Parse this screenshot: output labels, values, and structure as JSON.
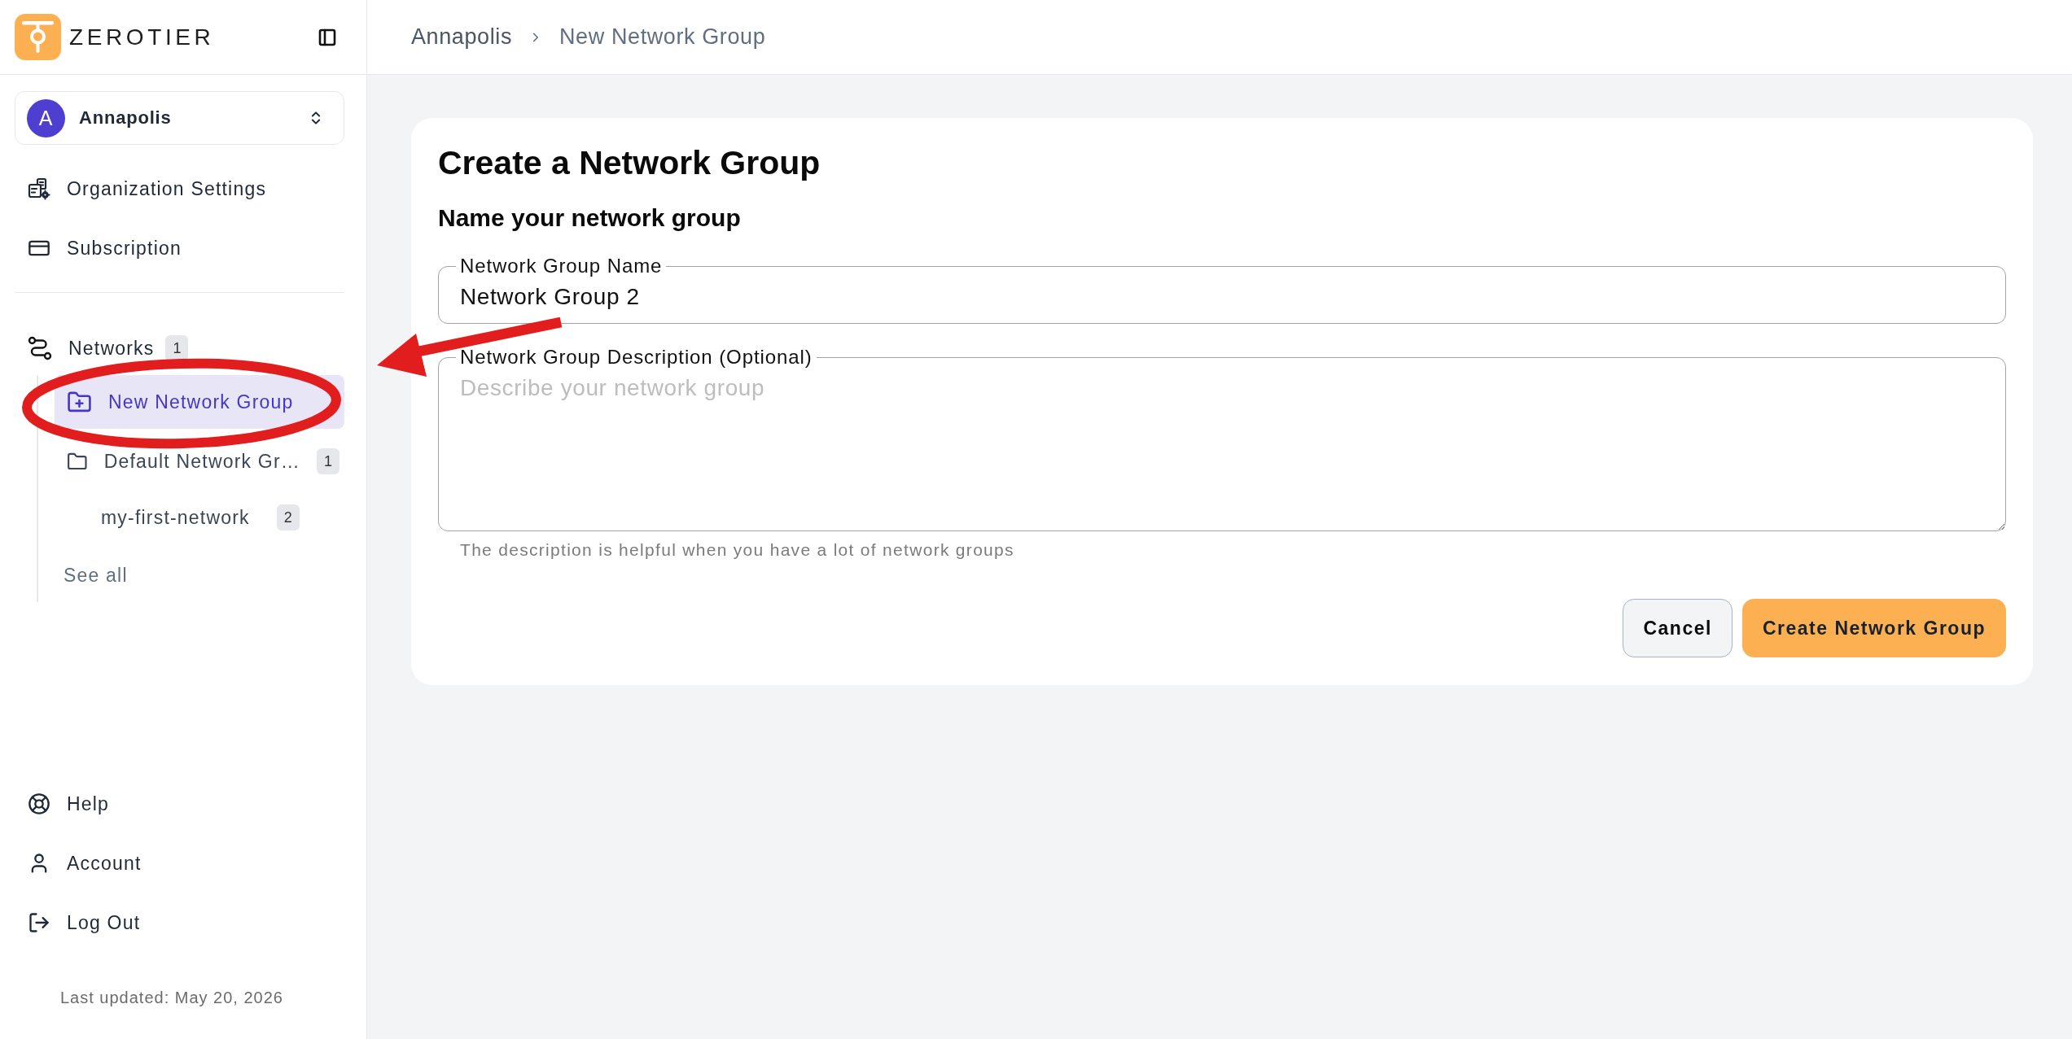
{
  "sidebar": {
    "logo": {
      "wordmark": "ZEROTIER"
    },
    "org_switcher": {
      "initial": "A",
      "name": "Annapolis"
    },
    "top_items": [
      {
        "kind": "organization-settings",
        "label": "Organization Settings",
        "selected": false
      },
      {
        "kind": "subscription",
        "label": "Subscription",
        "selected": false
      }
    ],
    "networks": {
      "label": "Networks",
      "count": "1",
      "selected": false,
      "children": [
        {
          "kind": "new-group",
          "label": "New Network Group",
          "selected": true
        },
        {
          "kind": "group",
          "label": "Default Network Gr…",
          "count": "1",
          "selected": false,
          "children": [
            {
              "label": "my-first-network",
              "count": "2",
              "selected": false
            }
          ]
        }
      ],
      "see_all": "See all"
    },
    "bottom_items": [
      {
        "kind": "help",
        "label": "Help",
        "selected": false
      },
      {
        "kind": "account",
        "label": "Account",
        "selected": false
      },
      {
        "kind": "log-out",
        "label": "Log Out",
        "selected": false
      }
    ],
    "last_updated": "Last updated: May 20, 2026"
  },
  "breadcrumb": [
    {
      "label": "Annapolis"
    },
    {
      "label": "New Network Group"
    }
  ],
  "form": {
    "title": "Create a Network Group",
    "section_title": "Name your network group",
    "fields": [
      {
        "kind": "input",
        "label": "Network Group Name",
        "value": "Network Group 2"
      },
      {
        "kind": "textarea",
        "label": "Network Group Description (Optional)",
        "placeholder": "Describe your network group",
        "hint": "The description is helpful when you have a lot of network groups"
      }
    ],
    "buttons": [
      {
        "kind": "secondary",
        "label": "Cancel"
      },
      {
        "kind": "primary",
        "label": "Create Network Group"
      }
    ]
  }
}
